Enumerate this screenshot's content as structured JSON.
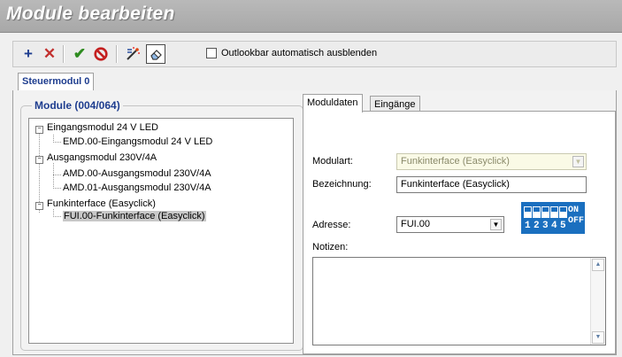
{
  "window": {
    "title": "Module bearbeiten"
  },
  "toolbar": {
    "icons": [
      "plus-icon",
      "cross-icon",
      "checkmark-icon",
      "cancel-icon",
      "wand-icon",
      "eraser-icon"
    ],
    "checkbox_label": "Outlookbar automatisch ausblenden",
    "checkbox_checked": false
  },
  "main_tab": {
    "label": "Steuermodul 0"
  },
  "modules": {
    "title": "Module (004/064)",
    "tree": [
      {
        "label": "Eingangsmodul 24 V LED",
        "level": 0
      },
      {
        "label": "EMD.00-Eingangsmodul 24 V LED",
        "level": 1
      },
      {
        "label": "Ausgangsmodul 230V/4A",
        "level": 0
      },
      {
        "label": "AMD.00-Ausgangsmodul 230V/4A",
        "level": 1
      },
      {
        "label": "AMD.01-Ausgangsmodul 230V/4A",
        "level": 1
      },
      {
        "label": "Funkinterface (Easyclick)",
        "level": 0
      },
      {
        "label": "FUI.00-Funkinterface (Easyclick)",
        "level": 1,
        "selected": true
      }
    ]
  },
  "detail_tabs": {
    "active": "Moduldaten",
    "other": "Eingänge"
  },
  "form": {
    "modulart_label": "Modulart:",
    "modulart_value": "Funkinterface (Easyclick)",
    "bezeichnung_label": "Bezeichnung:",
    "bezeichnung_value": "Funkinterface (Easyclick)",
    "adresse_label": "Adresse:",
    "adresse_value": "FUI.00",
    "notizen_label": "Notizen:",
    "notizen_value": ""
  },
  "dip_switch": {
    "on_label": "ON",
    "off_label": "OFF",
    "numbers": [
      "1",
      "2",
      "3",
      "4",
      "5"
    ],
    "color": "#1a6fbf"
  }
}
